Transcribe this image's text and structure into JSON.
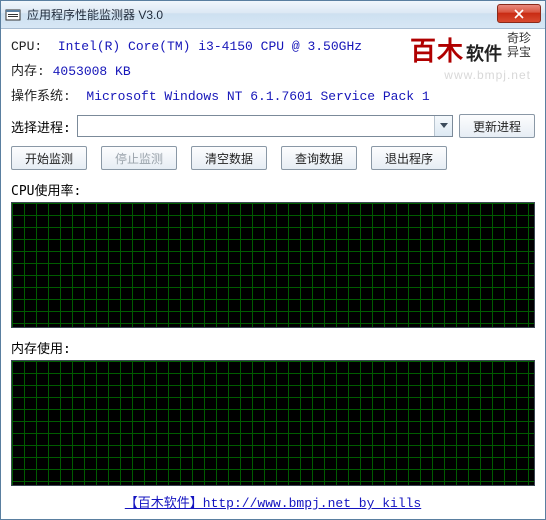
{
  "window": {
    "title": "应用程序性能监测器 V3.0"
  },
  "info": {
    "cpu_label": "CPU:  ",
    "cpu_value": "Intel(R) Core(TM) i3-4150 CPU @ 3.50GHz",
    "mem_label": "内存: ",
    "mem_value": "4053008 KB",
    "os_label": "操作系统:  ",
    "os_value": "Microsoft Windows NT 6.1.7601 Service Pack 1"
  },
  "logo": {
    "brand_red": "百木",
    "brand_black": "软件",
    "tag1": "奇珍",
    "tag2": "异宝",
    "url": "www.bmpj.net"
  },
  "process": {
    "label": "选择进程:",
    "value": "",
    "refresh_btn": "更新进程"
  },
  "buttons": {
    "start": "开始监测",
    "stop": "停止监测",
    "clear": "清空数据",
    "query": "查询数据",
    "exit": "退出程序"
  },
  "sections": {
    "cpu": "CPU使用率:",
    "mem": "内存使用:"
  },
  "footer": {
    "text": "【百木软件】http://www.bmpj.net  by kills"
  }
}
